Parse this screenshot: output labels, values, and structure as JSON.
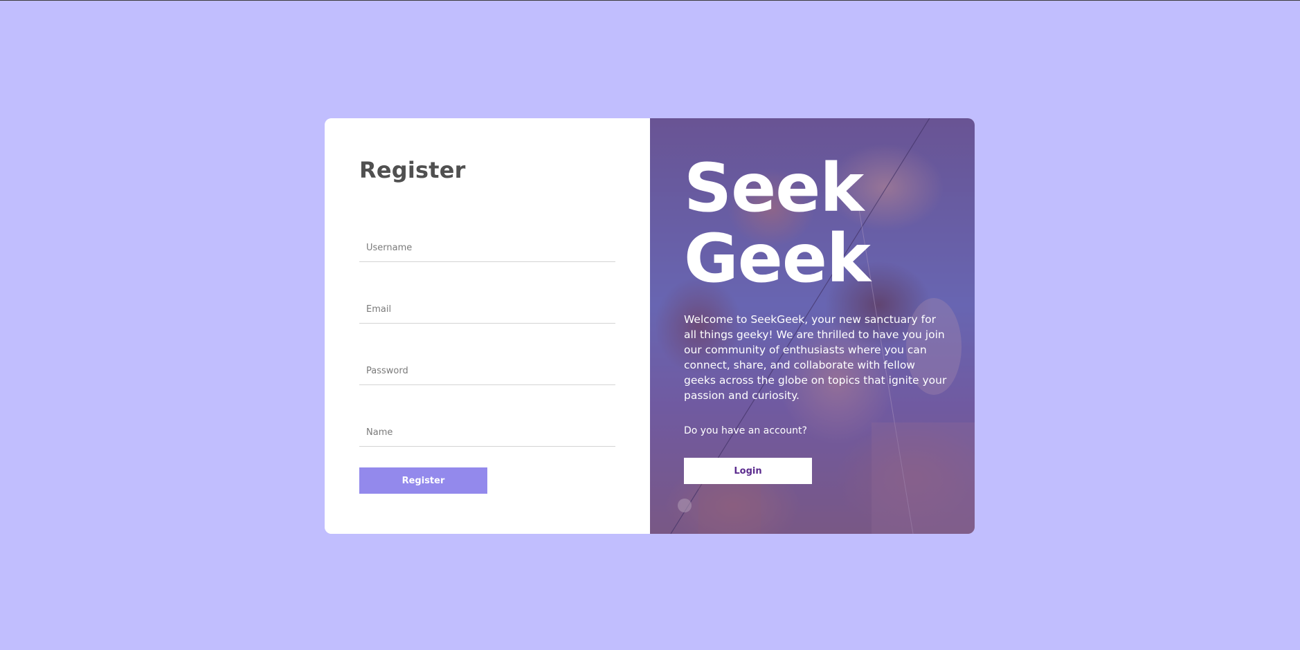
{
  "register": {
    "title": "Register",
    "fields": [
      {
        "placeholder": "Username"
      },
      {
        "placeholder": "Email"
      },
      {
        "placeholder": "Password"
      },
      {
        "placeholder": "Name"
      }
    ],
    "submit_label": "Register"
  },
  "hero": {
    "brand_line1": "Seek",
    "brand_line2": "Geek",
    "welcome_text": "Welcome to SeekGeek, your new sanctuary for all things geeky! We are thrilled to have you join our community of enthusiasts where you can connect, share, and collaborate with fellow geeks across the globe on topics that ignite your passion and curiosity.",
    "account_question": "Do you have an account?",
    "login_label": "Login"
  },
  "colors": {
    "page_background": "#c1befe",
    "register_button": "#9389ec",
    "login_text": "#5b2b8e",
    "title_text": "#505050"
  }
}
